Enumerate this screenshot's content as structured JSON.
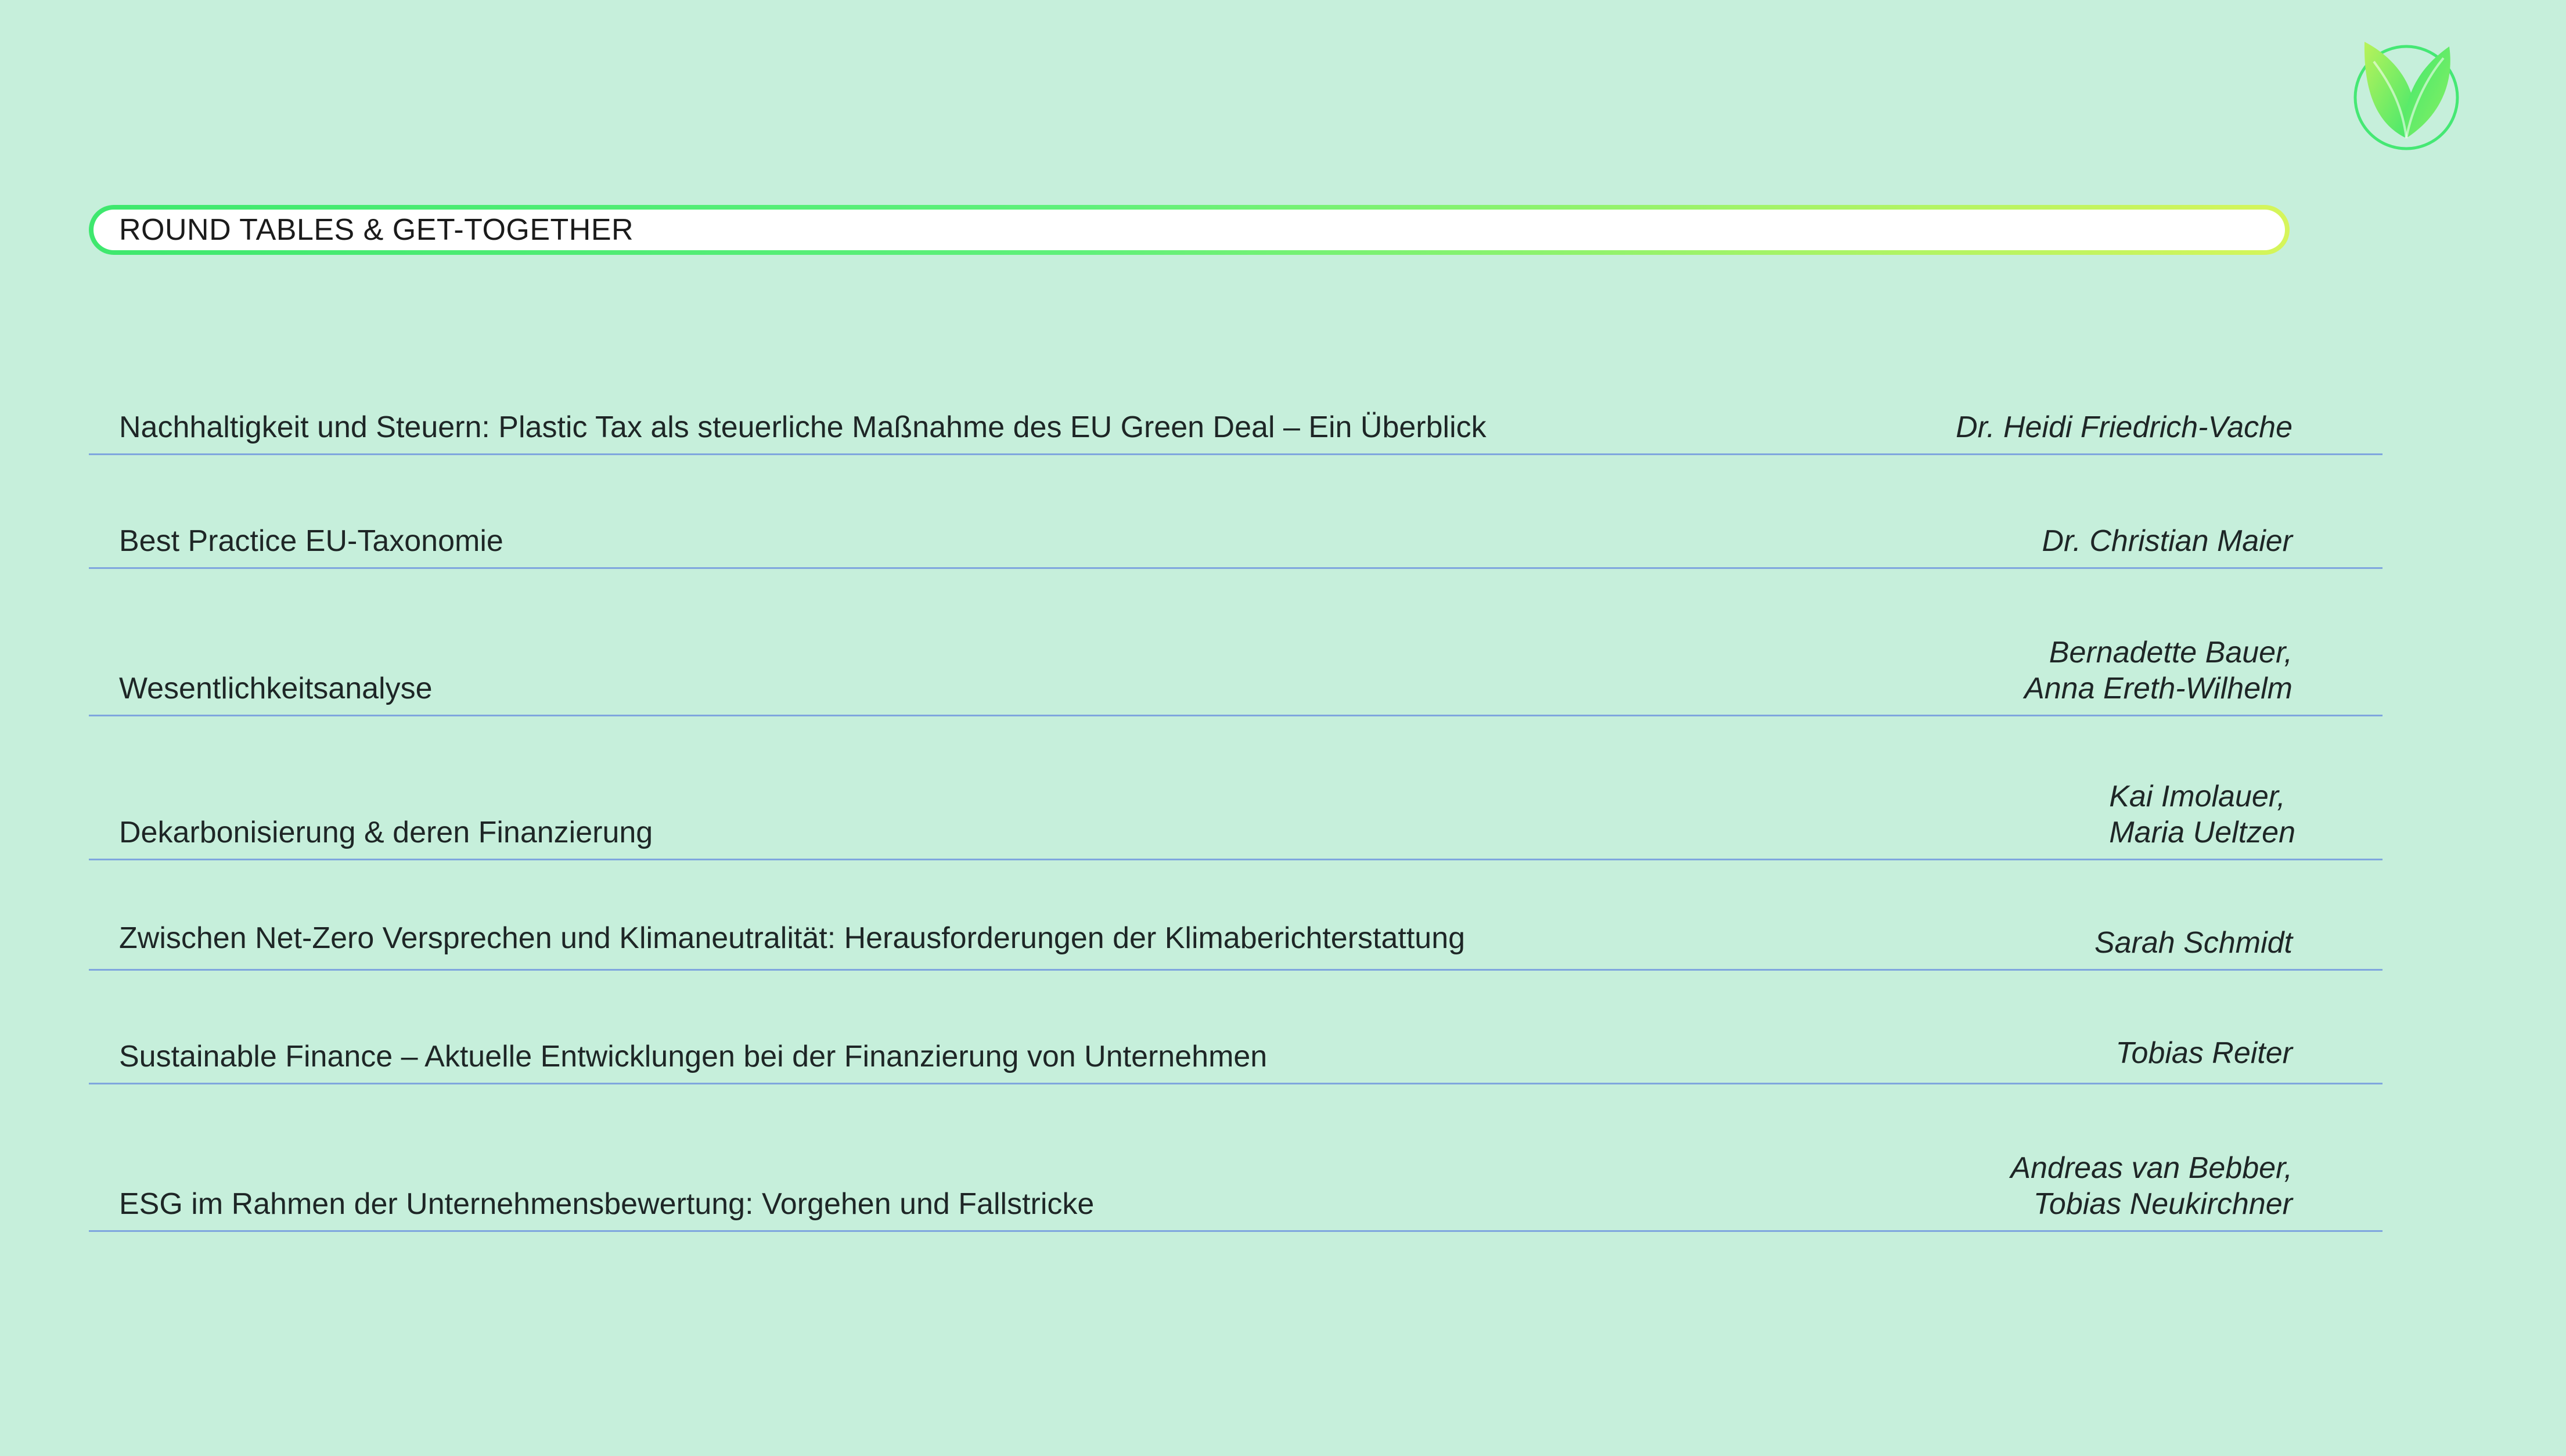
{
  "section": {
    "title": "ROUND TABLES & GET-TOGETHER"
  },
  "logo": {
    "icon": "leaf-logo-icon",
    "colors": [
      "#3ee86e",
      "#b7f25a"
    ]
  },
  "colors": {
    "background": "#c6efdb",
    "divider": "#7fa6de",
    "accent_start": "#3ee86e",
    "accent_end": "#d6f55a"
  },
  "sessions": [
    {
      "topic": "Nachhaltigkeit und Steuern: Plastic Tax als steuerliche Maßnahme des EU Green Deal – Ein Überblick",
      "speakers": [
        "Dr. Heidi Friedrich-Vache"
      ]
    },
    {
      "topic": "Best Practice EU-Taxonomie",
      "speakers": [
        "Dr. Christian Maier"
      ]
    },
    {
      "topic": "Wesentlichkeitsanalyse",
      "speakers": [
        "Bernadette Bauer,",
        "Anna Ereth-Wilhelm"
      ]
    },
    {
      "topic": "Dekarbonisierung & deren Finanzierung",
      "speakers": [
        "Kai Imolauer,",
        "Maria Ueltzen"
      ]
    },
    {
      "topic": "Zwischen Net-Zero Versprechen und Klimaneutralität: Herausforderungen der Klimaberichterstattung",
      "speakers": [
        "Sarah Schmidt"
      ]
    },
    {
      "topic": "Sustainable Finance – Aktuelle Entwicklungen bei der Finanzierung von Unternehmen",
      "speakers": [
        "Tobias Reiter"
      ]
    },
    {
      "topic": "ESG im Rahmen der Unternehmensbewertung: Vorgehen und Fallstricke",
      "speakers": [
        "Andreas van Bebber,",
        "Tobias Neukirchner"
      ]
    }
  ]
}
